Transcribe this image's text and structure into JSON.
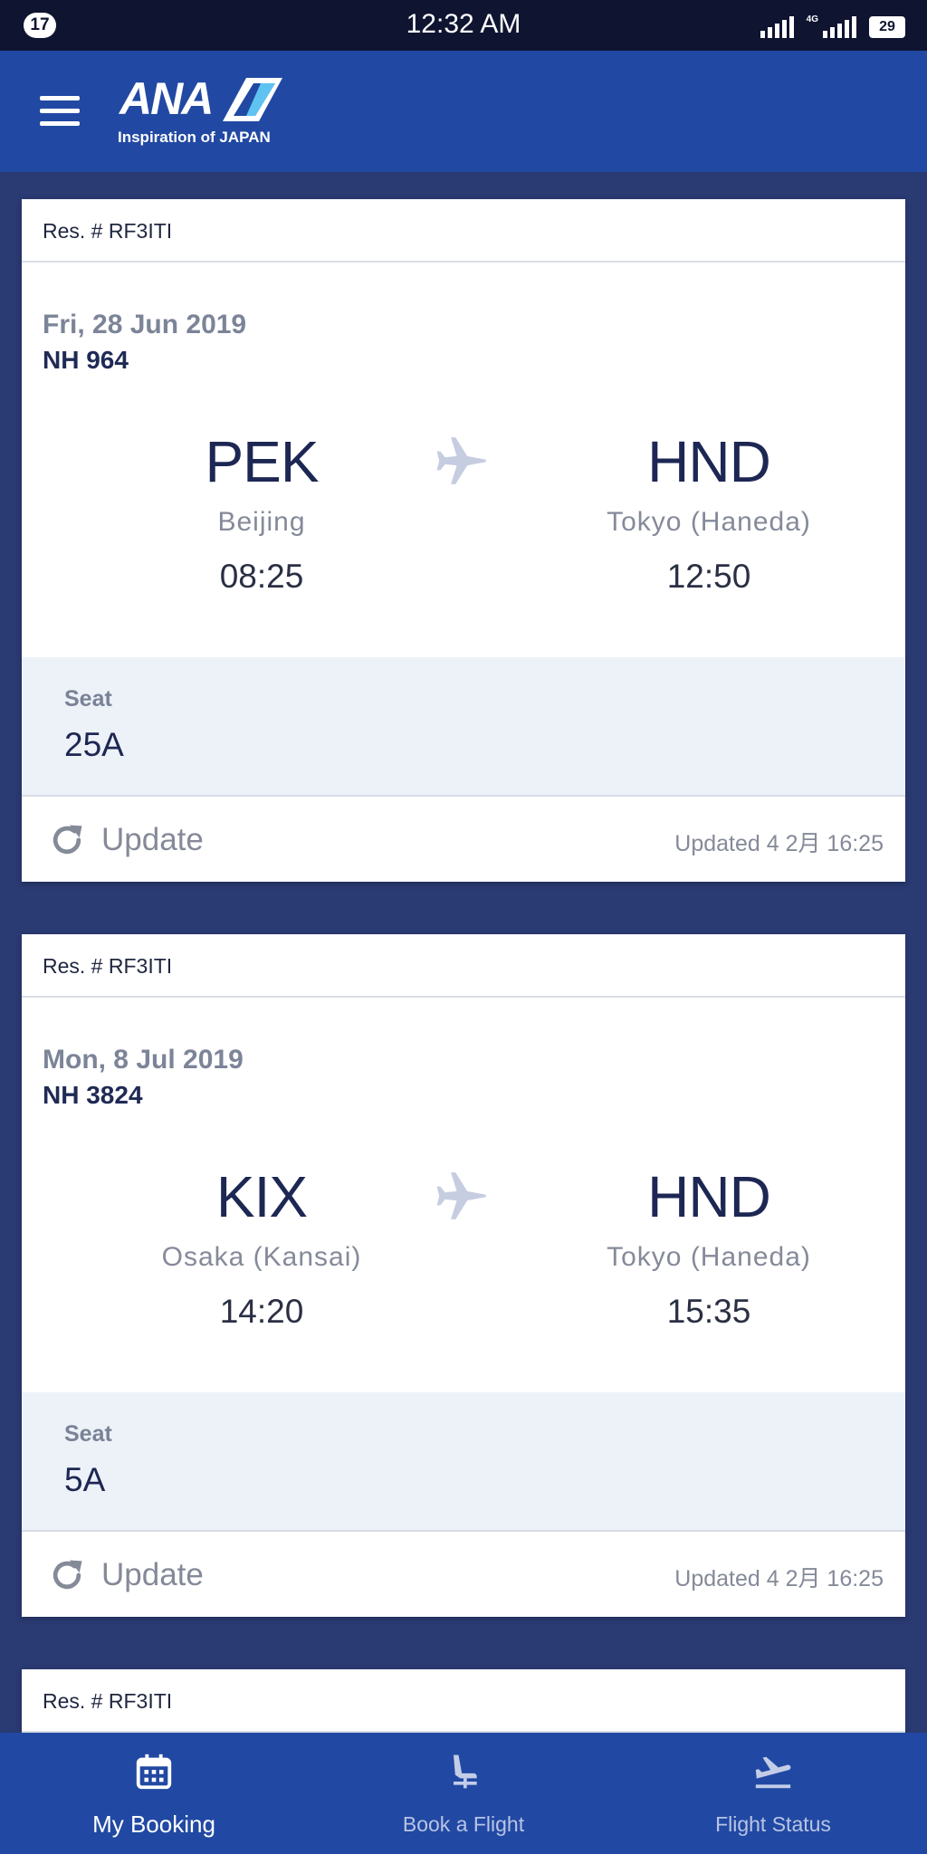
{
  "status_bar": {
    "notification_count": "17",
    "time": "12:32 AM",
    "network_label": "4G",
    "battery": "29"
  },
  "header": {
    "logo_text": "ANA",
    "logo_tagline": "Inspiration of JAPAN"
  },
  "bookings": [
    {
      "reservation": "Res. # RF3ITI",
      "date": "Fri, 28 Jun 2019",
      "flight_number": "NH 964",
      "origin": {
        "code": "PEK",
        "city": "Beijing",
        "time": "08:25"
      },
      "destination": {
        "code": "HND",
        "city": "Tokyo (Haneda)",
        "time": "12:50"
      },
      "seat_label": "Seat",
      "seat": "25A",
      "update_label": "Update",
      "updated_at": "Updated 4 2月 16:25"
    },
    {
      "reservation": "Res. # RF3ITI",
      "date": "Mon, 8 Jul 2019",
      "flight_number": "NH 3824",
      "origin": {
        "code": "KIX",
        "city": "Osaka (Kansai)",
        "time": "14:20"
      },
      "destination": {
        "code": "HND",
        "city": "Tokyo (Haneda)",
        "time": "15:35"
      },
      "seat_label": "Seat",
      "seat": "5A",
      "update_label": "Update",
      "updated_at": "Updated 4 2月 16:25"
    },
    {
      "reservation": "Res. # RF3ITI"
    }
  ],
  "bottom_nav": {
    "items": [
      {
        "label": "My Booking",
        "icon": "calendar-icon",
        "active": true
      },
      {
        "label": "Book a Flight",
        "icon": "seat-icon",
        "active": false
      },
      {
        "label": "Flight Status",
        "icon": "departure-icon",
        "active": false
      }
    ]
  },
  "colors": {
    "header": "#2149a3",
    "background": "#2a3a72",
    "status_bar": "#0f1431",
    "primary_text": "#1d2753",
    "seat_panel": "#edf2f8"
  }
}
